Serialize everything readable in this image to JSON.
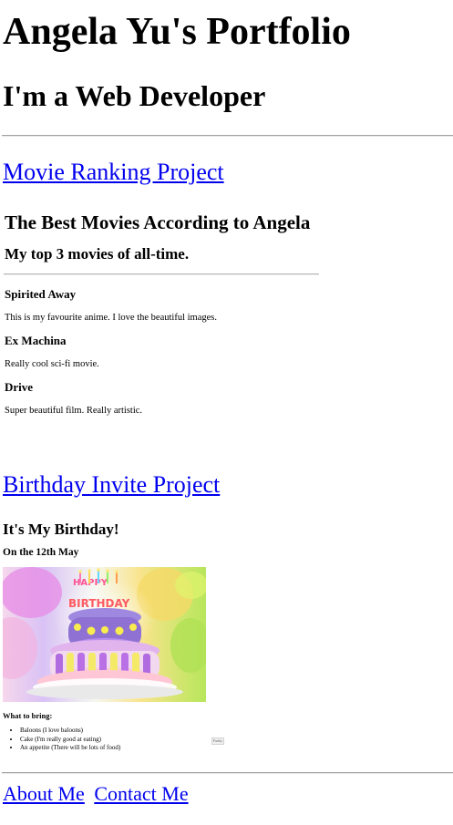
{
  "header": {
    "name_title": "Angela Yu's Portfolio",
    "subtitle": "I'm a Web Developer"
  },
  "movie_project": {
    "link_text": "Movie Ranking Project",
    "title": "The Best Movies According to Angela",
    "subtitle": "My top 3 movies of all-time.",
    "movies": [
      {
        "name": "Spirited Away",
        "description": "This is my favourite anime. I love the beautiful images."
      },
      {
        "name": "Ex Machina",
        "description": "Really cool sci-fi movie."
      },
      {
        "name": "Drive",
        "description": "Super beautiful film. Really artistic."
      }
    ]
  },
  "birthday_project": {
    "link_text": "Birthday Invite Project",
    "title": "It's My Birthday!",
    "subtitle": "On the 12th May",
    "image": {
      "cake_text_top": "HAPPY",
      "cake_text_bottom": "BIRTHDAY"
    },
    "bring_title": "What to bring:",
    "bring_items": [
      "Baloons (I love baloons)",
      "Cake (I'm really good at eating)",
      "An appetite (There will be lots of food)"
    ],
    "embed_label": "Funky"
  },
  "footer": {
    "nav": [
      "About Me",
      "Contact Me"
    ]
  },
  "colors": {
    "link": "#0000ee",
    "text": "#000000",
    "rule": "#a3a3a3"
  }
}
